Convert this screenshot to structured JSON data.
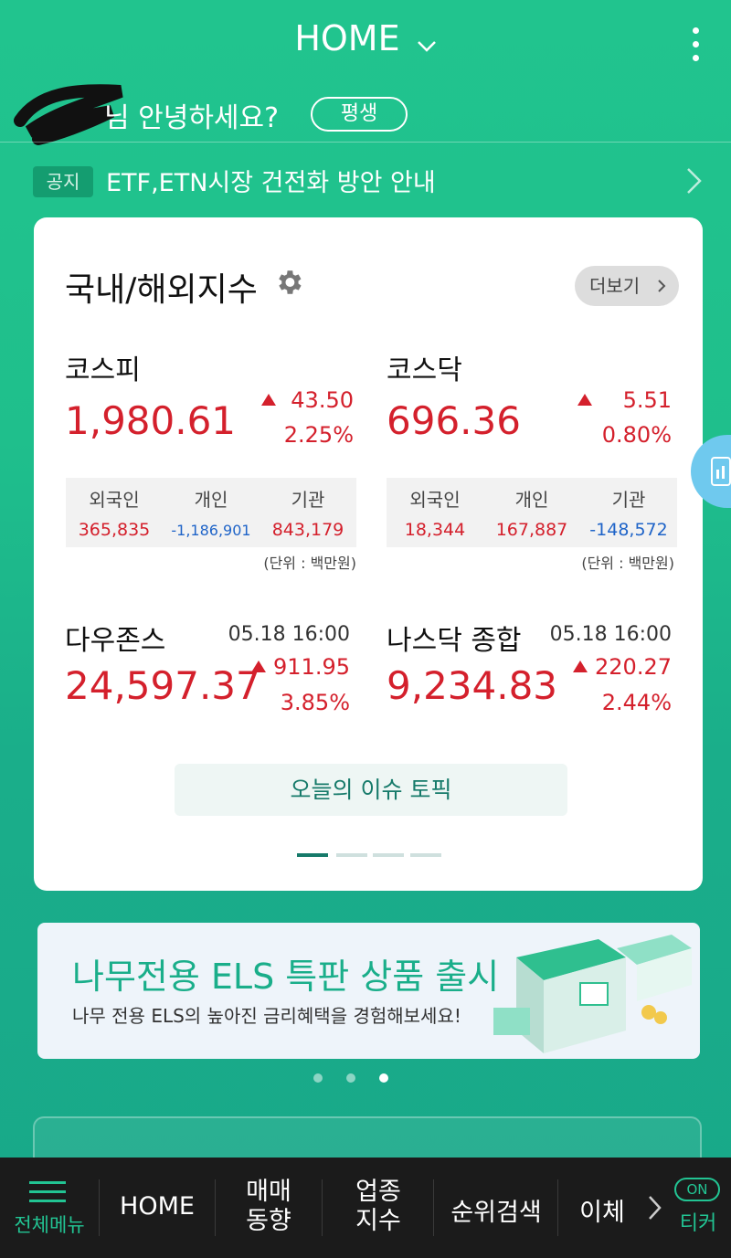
{
  "header": {
    "title": "HOME"
  },
  "greeting": {
    "text": "님 안녕하세요?",
    "grade": "평생"
  },
  "notice": {
    "tag": "공지",
    "text": "ETF,ETN시장 건전화 방안 안내"
  },
  "indices_card": {
    "title": "국내/해외지수",
    "more_label": "더보기",
    "domestic": [
      {
        "name": "코스피",
        "value": "1,980.61",
        "change": "43.50",
        "pct": "2.25%",
        "investors": [
          {
            "label": "외국인",
            "value": "365,835",
            "trend": "up"
          },
          {
            "label": "개인",
            "value": "-1,186,901",
            "trend": "down"
          },
          {
            "label": "기관",
            "value": "843,179",
            "trend": "up"
          }
        ],
        "unit": "(단위 : 백만원)"
      },
      {
        "name": "코스닥",
        "value": "696.36",
        "change": "5.51",
        "pct": "0.80%",
        "investors": [
          {
            "label": "외국인",
            "value": "18,344",
            "trend": "up"
          },
          {
            "label": "개인",
            "value": "167,887",
            "trend": "up"
          },
          {
            "label": "기관",
            "value": "-148,572",
            "trend": "down"
          }
        ],
        "unit": "(단위 : 백만원)"
      }
    ],
    "overseas": [
      {
        "name": "다우존스",
        "time": "05.18 16:00",
        "value": "24,597.37",
        "change": "911.95",
        "pct": "3.85%"
      },
      {
        "name": "나스닥 종합",
        "time": "05.18 16:00",
        "value": "9,234.83",
        "change": "220.27",
        "pct": "2.44%"
      }
    ],
    "issue_button": "오늘의 이슈 토픽",
    "pager": {
      "pages": 4,
      "active": 1
    }
  },
  "banner": {
    "title": "나무전용 ELS 특판 상품 출시",
    "subtitle": "나무 전용 ELS의 높아진 금리혜택을 경험해보세요!",
    "dots": {
      "count": 3,
      "active": 3
    }
  },
  "bottom_nav": {
    "menu_label": "전체메뉴",
    "items": [
      {
        "label": "HOME"
      },
      {
        "line1": "매매",
        "line2": "동향"
      },
      {
        "line1": "업종",
        "line2": "지수"
      },
      {
        "label": "순위검색"
      },
      {
        "label": "이체"
      }
    ],
    "ticker_toggle": "ON",
    "ticker_label": "티커"
  },
  "colors": {
    "brand": "#21c48e",
    "up": "#d4202c",
    "down": "#1f64c8",
    "nav_bg": "#1b1b1b"
  }
}
